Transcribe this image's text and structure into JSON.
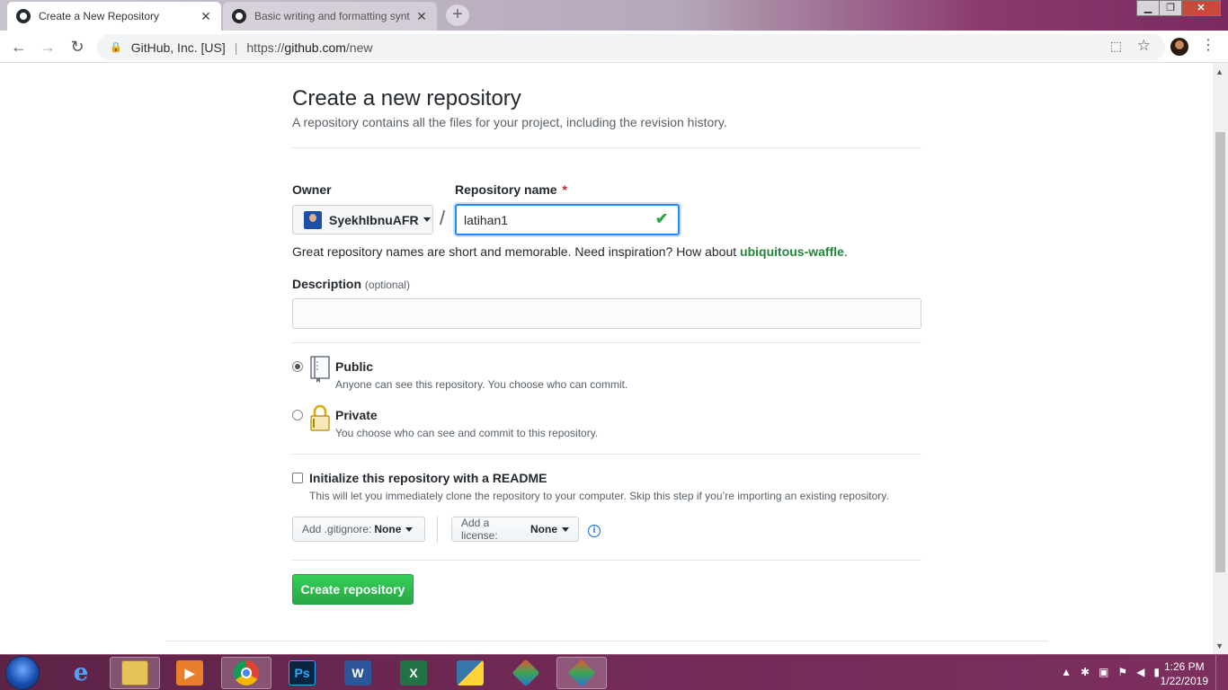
{
  "browser": {
    "tabs": [
      {
        "title": "Create a New Repository",
        "close": "✕"
      },
      {
        "title": "Basic writing and formatting synt",
        "close": "✕"
      }
    ],
    "new_tab": "+",
    "window_controls": {
      "minimize": "▁",
      "maximize": "❐",
      "close": "✕"
    },
    "back": "←",
    "forward": "→",
    "reload": "↻",
    "site_identity": "GitHub, Inc. [US]",
    "url_scheme": "https://",
    "url_host": "github.com",
    "url_path": "/new",
    "translate_icon": "translate-icon",
    "bookmark_icon": "star-icon",
    "menu_icon": "kebab-menu-icon"
  },
  "page": {
    "title": "Create a new repository",
    "subtitle": "A repository contains all the files for your project, including the revision history.",
    "owner": {
      "label": "Owner",
      "value": "SyekhIbnuAFR"
    },
    "repo_name": {
      "label": "Repository name",
      "required_mark": "*",
      "value": "latihan1"
    },
    "slash": "/",
    "hint_prefix": "Great repository names are short and memorable. Need inspiration? How about ",
    "hint_suggestion": "ubiquitous-waffle",
    "hint_suffix": ".",
    "description": {
      "label": "Description",
      "optional": "(optional)",
      "value": ""
    },
    "visibility": [
      {
        "title": "Public",
        "desc": "Anyone can see this repository. You choose who can commit.",
        "selected": true
      },
      {
        "title": "Private",
        "desc": "You choose who can see and commit to this repository.",
        "selected": false
      }
    ],
    "readme": {
      "title": "Initialize this repository with a README",
      "desc": "This will let you immediately clone the repository to your computer. Skip this step if you’re importing an existing repository.",
      "checked": false
    },
    "gitignore": {
      "label": "Add .gitignore:",
      "value": "None"
    },
    "license": {
      "label": "Add a license:",
      "value": "None"
    },
    "info_glyph": "i",
    "create_button": "Create repository",
    "check_glyph": "✔"
  },
  "taskbar": {
    "apps": [
      "internet-explorer",
      "file-explorer",
      "media-player",
      "chrome",
      "photoshop",
      "word",
      "excel",
      "python",
      "git",
      "git-gui"
    ],
    "ps_label": "Ps",
    "word_label": "W",
    "excel_label": "X",
    "time": "1:26 PM",
    "date": "1/22/2019"
  },
  "colors": {
    "accent": "#2188ff",
    "success": "#28a745",
    "link_green": "#22863a",
    "taskbar": "#722a57"
  }
}
